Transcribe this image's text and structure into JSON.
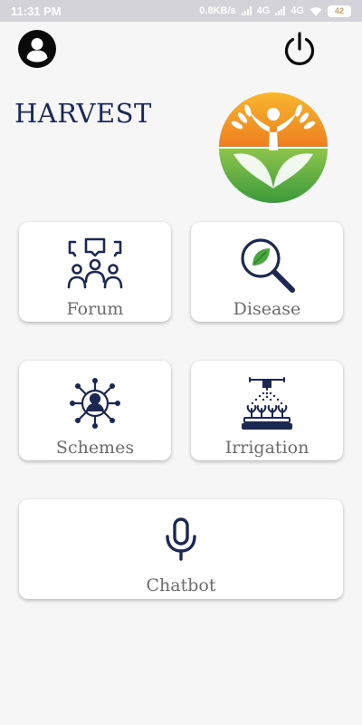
{
  "status_bar": {
    "time": "11:31 PM",
    "speed": "0.8KB/s",
    "net1": "4G",
    "net2": "4G",
    "battery": "42"
  },
  "header": {
    "profile_icon": "account-circle-icon",
    "power_icon": "power-icon"
  },
  "app": {
    "title": "HARVEST",
    "logo_icon": "harvest-logo",
    "colors": {
      "title": "#1b2853",
      "icon": "#1b2853",
      "label": "#6b6b6b",
      "logo_orange": "#f5a623",
      "logo_green": "#5cae3a"
    }
  },
  "menu": {
    "forum": {
      "label": "Forum",
      "icon": "people-chat-icon"
    },
    "disease": {
      "label": "Disease",
      "icon": "leaf-magnifier-icon"
    },
    "schemes": {
      "label": "Schemes",
      "icon": "person-network-icon"
    },
    "irrigation": {
      "label": "Irrigation",
      "icon": "sprinkler-plants-icon"
    },
    "chatbot": {
      "label": "Chatbot",
      "icon": "microphone-icon"
    }
  }
}
